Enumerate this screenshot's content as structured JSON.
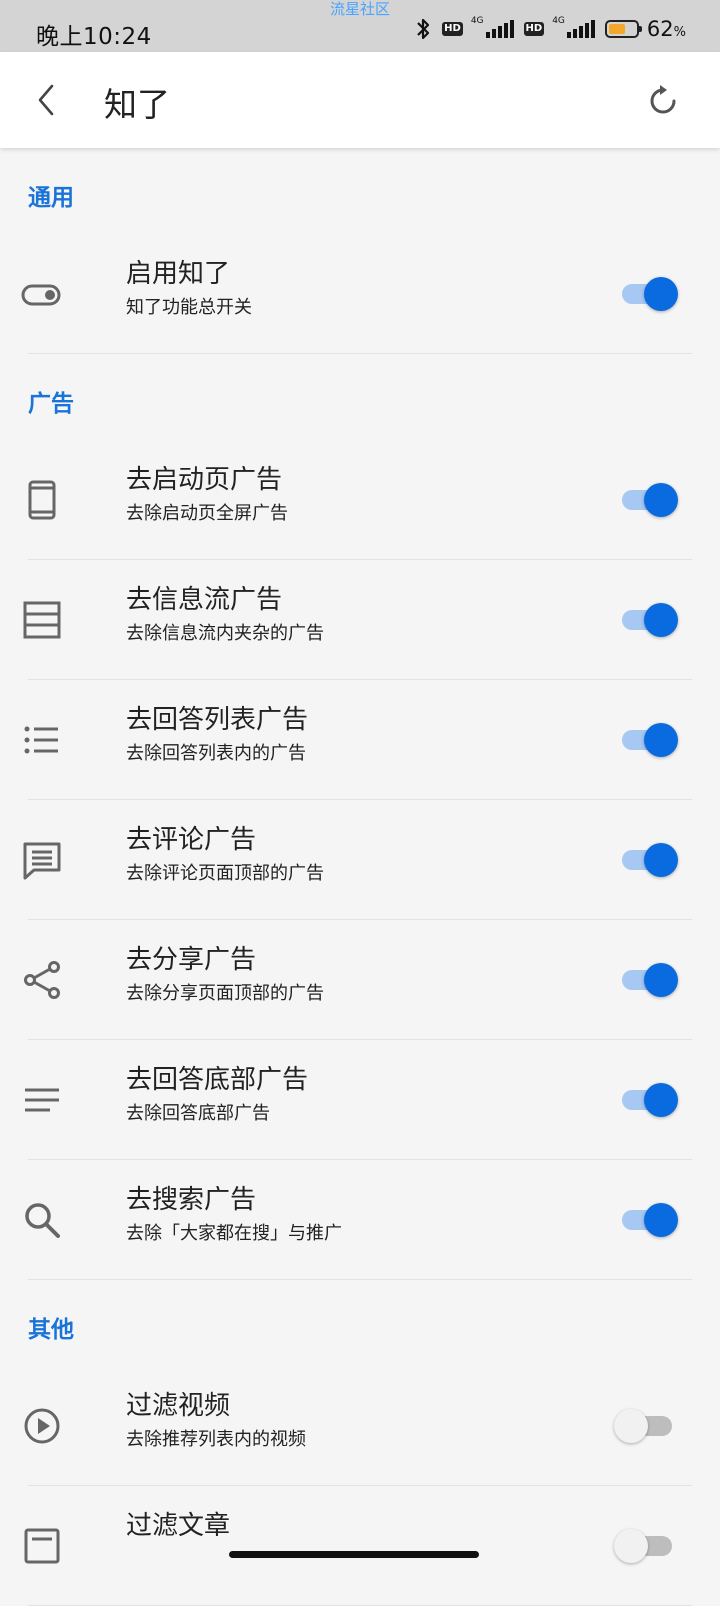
{
  "status": {
    "time": "晚上10:24",
    "watermark": "流星社区",
    "battery_text": "62",
    "battery_unit": "%",
    "battery_level": 0.62,
    "hd1": "HD",
    "net1": "4G",
    "hd2": "HD",
    "net2": "4G",
    "battery_color": "#f3a72b"
  },
  "appbar": {
    "title": "知了",
    "back_icon": "chevron-left-icon",
    "refresh_icon": "refresh-icon"
  },
  "accent_color": "#1a73d8",
  "sections": [
    {
      "title": "通用",
      "items": [
        {
          "title": "启用知了",
          "subtitle": "知了功能总开关",
          "icon": "toggle-icon",
          "enabled": true
        }
      ]
    },
    {
      "title": "广告",
      "items": [
        {
          "title": "去启动页广告",
          "subtitle": "去除启动页全屏广告",
          "icon": "phone-icon",
          "enabled": true
        },
        {
          "title": "去信息流广告",
          "subtitle": "去除信息流内夹杂的广告",
          "icon": "feed-icon",
          "enabled": true
        },
        {
          "title": "去回答列表广告",
          "subtitle": "去除回答列表内的广告",
          "icon": "list-icon",
          "enabled": true
        },
        {
          "title": "去评论广告",
          "subtitle": "去除评论页面顶部的广告",
          "icon": "comment-icon",
          "enabled": true
        },
        {
          "title": "去分享广告",
          "subtitle": "去除分享页面顶部的广告",
          "icon": "share-icon",
          "enabled": true
        },
        {
          "title": "去回答底部广告",
          "subtitle": "去除回答底部广告",
          "icon": "lines-icon",
          "enabled": true
        },
        {
          "title": "去搜索广告",
          "subtitle": "去除「大家都在搜」与推广",
          "icon": "search-icon",
          "enabled": true
        }
      ]
    },
    {
      "title": "其他",
      "items": [
        {
          "title": "过滤视频",
          "subtitle": "去除推荐列表内的视频",
          "icon": "play-circle-icon",
          "enabled": false
        },
        {
          "title": "过滤文章",
          "subtitle": "",
          "icon": "article-icon",
          "enabled": false
        }
      ]
    }
  ]
}
